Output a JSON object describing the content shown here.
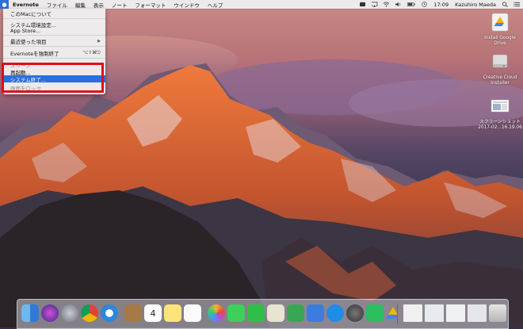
{
  "menubar": {
    "apple": "",
    "app_name": "Evernote",
    "menus": [
      "ファイル",
      "編集",
      "表示",
      "ノート",
      "フォーマット",
      "ウインドウ",
      "ヘルプ"
    ],
    "time": "17:09",
    "user": "Kazuhiro Maeda"
  },
  "apple_menu": {
    "about": "このMacについて",
    "system_prefs": "システム環境設定...",
    "app_store": "App Store...",
    "recent": "最近使った項目",
    "force_quit": "Evernoteを強制終了",
    "force_quit_shortcut": "⌥⇧⌘⎋",
    "sleep": "スリープ",
    "restart": "再起動...",
    "shutdown": "システム終了...",
    "lock": "画面をロック"
  },
  "desktop_icons": {
    "drive": "Install Google Drive",
    "creative_cloud": "Creative Cloud Installer",
    "screenshot_line1": "スクリーンショット",
    "screenshot_line2": "2017-02...16.19.06"
  },
  "dock": {
    "apps": [
      "finder",
      "siri",
      "launchpad",
      "chrome",
      "safari",
      "notes-book",
      "calendar",
      "stickies",
      "reminders",
      "photos",
      "messages",
      "facetime",
      "preview",
      "numbers",
      "keynote",
      "app-store",
      "system-prefs",
      "evernote",
      "drive",
      "window-1",
      "window-2",
      "window-3",
      "window-4",
      "trash"
    ],
    "calendar_day": "4"
  }
}
